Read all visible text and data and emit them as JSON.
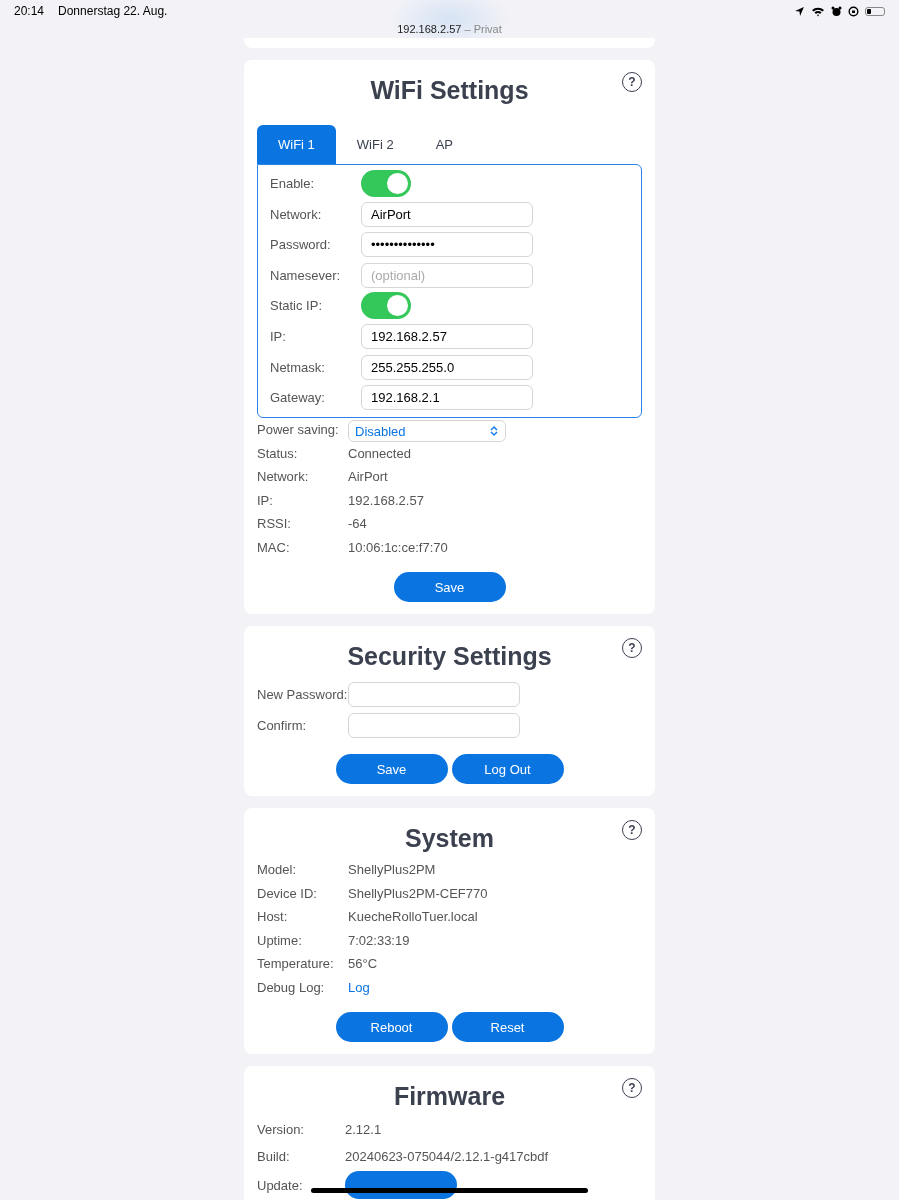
{
  "status_bar": {
    "time": "20:14",
    "date": "Donnerstag 22. Aug."
  },
  "address_bar": {
    "host": "192.168.2.57",
    "suffix": "– Privat"
  },
  "wifi": {
    "title": "WiFi Settings",
    "tabs": [
      {
        "label": "WiFi 1",
        "selected": true
      },
      {
        "label": "WiFi 2",
        "selected": false
      },
      {
        "label": "AP",
        "selected": false
      }
    ],
    "fields": [
      {
        "kind": "toggle",
        "label": "Enable:",
        "on": true
      },
      {
        "kind": "text",
        "label": "Network:",
        "value": "AirPort"
      },
      {
        "kind": "text",
        "label": "Password:",
        "value": "••••••••••••••"
      },
      {
        "kind": "text",
        "label": "Namesever:",
        "placeholder": "(optional)"
      },
      {
        "kind": "toggle",
        "label": "Static IP:",
        "on": true
      },
      {
        "kind": "text",
        "label": "IP:",
        "value": "192.168.2.57"
      },
      {
        "kind": "text",
        "label": "Netmask:",
        "value": "255.255.255.0"
      },
      {
        "kind": "text",
        "label": "Gateway:",
        "value": "192.168.2.1"
      }
    ],
    "power_saving": {
      "label": "Power saving:",
      "value": "Disabled"
    },
    "info": [
      {
        "label": "Status:",
        "value": "Connected"
      },
      {
        "label": "Network:",
        "value": "AirPort"
      },
      {
        "label": "IP:",
        "value": "192.168.2.57"
      },
      {
        "label": "RSSI:",
        "value": "-64"
      },
      {
        "label": "MAC:",
        "value": "10:06:1c:ce:f7:70"
      }
    ],
    "buttons": [
      "Save"
    ]
  },
  "security": {
    "title": "Security Settings",
    "fields": [
      {
        "label": "New Password:"
      },
      {
        "label": "Confirm:"
      }
    ],
    "buttons": [
      "Save",
      "Log Out"
    ]
  },
  "system": {
    "title": "System",
    "info": [
      {
        "kind": "text",
        "label": "Model:",
        "value": "ShellyPlus2PM"
      },
      {
        "kind": "text",
        "label": "Device ID:",
        "value": "ShellyPlus2PM-CEF770"
      },
      {
        "kind": "text",
        "label": "Host:",
        "value": "KuecheRolloTuer.local"
      },
      {
        "kind": "text",
        "label": "Uptime:",
        "value": "7:02:33:19"
      },
      {
        "kind": "text",
        "label": "Temperature:",
        "value": "56°C"
      },
      {
        "kind": "link",
        "label": "Debug Log:",
        "value": "Log"
      }
    ],
    "buttons": [
      "Reboot",
      "Reset"
    ]
  },
  "firmware": {
    "title": "Firmware",
    "info": [
      {
        "label": "Version:",
        "value": "2.12.1"
      },
      {
        "label": "Build:",
        "value": "20240623-075044/2.12.1-g417cbdf"
      }
    ],
    "update": {
      "label": "Update:"
    }
  },
  "help_label": "?"
}
